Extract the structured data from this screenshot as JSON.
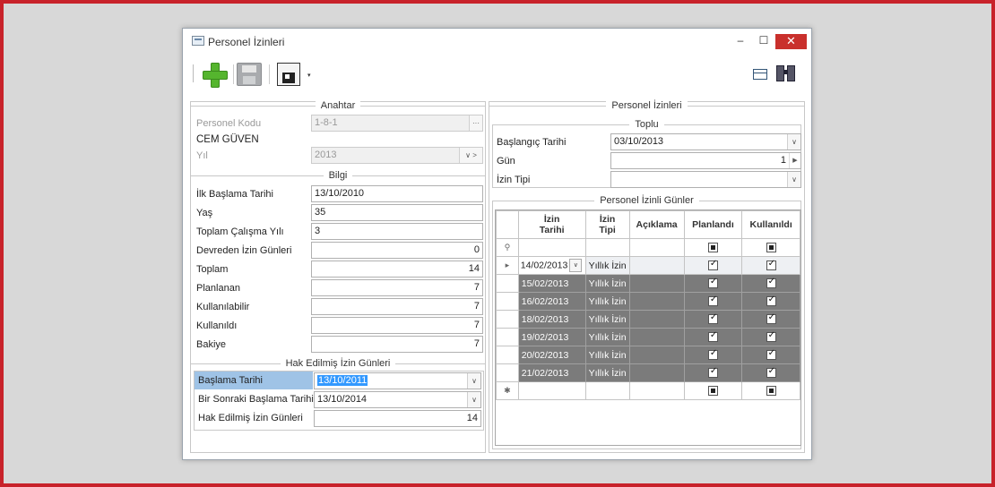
{
  "window": {
    "title": "Personel İzinleri",
    "controls": {
      "minimize": "–",
      "maximize": "☐",
      "close": "✕"
    }
  },
  "toolbar": {
    "icons": [
      "add-icon",
      "save-icon",
      "save-as-icon",
      "layout-icon",
      "binoculars-icon"
    ],
    "dropdown_caret": "▾"
  },
  "left": {
    "anahtar": {
      "title": "Anahtar",
      "personel_kodu_label": "Personel Kodu",
      "personel_kodu_value": "1-8-1",
      "personel_kodu_btn": "···",
      "name": "CEM GÜVEN",
      "yil_label": "Yıl",
      "yil_value": "2013",
      "yil_btns": "∨ >"
    },
    "bilgi": {
      "title": "Bilgi",
      "fields": [
        {
          "label": "İlk Başlama Tarihi",
          "value": "13/10/2010"
        },
        {
          "label": "Yaş",
          "value": "35"
        },
        {
          "label": "Toplam Çalışma Yılı",
          "value": "3"
        },
        {
          "label": "Devreden İzin Günleri",
          "value": "0"
        },
        {
          "label": "Toplam",
          "value": "14"
        },
        {
          "label": "Planlanan",
          "value": "7"
        },
        {
          "label": "Kullanılabilir",
          "value": "7"
        },
        {
          "label": "Kullanıldı",
          "value": "7"
        },
        {
          "label": "Bakiye",
          "value": "7"
        }
      ]
    },
    "hak": {
      "title": "Hak Edilmiş İzin Günleri",
      "baslama_label": "Başlama Tarihi",
      "baslama_value": "13/10/2011",
      "sonraki_label": "Bir Sonraki Başlama Tarihi",
      "sonraki_value": "13/10/2014",
      "hak_label": "Hak Edilmiş İzin Günleri",
      "hak_value": "14"
    }
  },
  "right": {
    "title": "Personel İzinleri",
    "toplu": {
      "title": "Toplu",
      "baslangic_label": "Başlangıç Tarihi",
      "baslangic_value": "03/10/2013",
      "gun_label": "Gün",
      "gun_value": "1",
      "izin_tipi_label": "İzin Tipi",
      "izin_tipi_value": ""
    },
    "grid": {
      "title": "Personel İzinli Günler",
      "columns": [
        "İzin\nTarihi",
        "İzin\nTipi",
        "Açıklama",
        "Planlandı",
        "Kullanıldı"
      ],
      "filter_icon": "⚲",
      "new_row_icon": "✱",
      "current_icon": "▸",
      "rows": [
        {
          "tarih": "14/02/2013",
          "tip": "Yıllık İzin",
          "aciklama": "",
          "planlandi": true,
          "kullanildi": true
        },
        {
          "tarih": "15/02/2013",
          "tip": "Yıllık İzin",
          "aciklama": "",
          "planlandi": true,
          "kullanildi": true
        },
        {
          "tarih": "16/02/2013",
          "tip": "Yıllık İzin",
          "aciklama": "",
          "planlandi": true,
          "kullanildi": true
        },
        {
          "tarih": "18/02/2013",
          "tip": "Yıllık İzin",
          "aciklama": "",
          "planlandi": true,
          "kullanildi": true
        },
        {
          "tarih": "19/02/2013",
          "tip": "Yıllık İzin",
          "aciklama": "",
          "planlandi": true,
          "kullanildi": true
        },
        {
          "tarih": "20/02/2013",
          "tip": "Yıllık İzin",
          "aciklama": "",
          "planlandi": true,
          "kullanildi": true
        },
        {
          "tarih": "21/02/2013",
          "tip": "Yıllık İzin",
          "aciklama": "",
          "planlandi": true,
          "kullanildi": true
        }
      ]
    }
  },
  "colors": {
    "frame": "#c8222a",
    "selected_row": "#7b7b7b",
    "highlight": "#9fc3e6",
    "close_button": "#c9302c",
    "add_green": "#55b52e"
  }
}
